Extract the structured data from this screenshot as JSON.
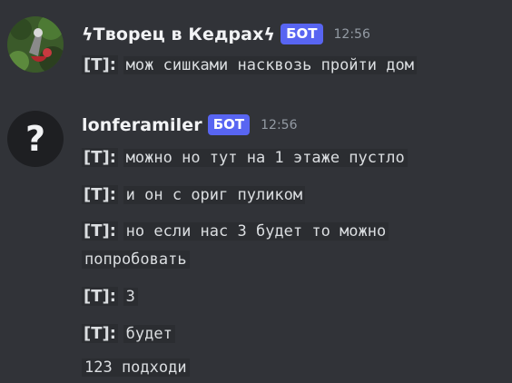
{
  "messages": [
    {
      "username": "ϟТворец в Кедрахϟ",
      "badge": "БОТ",
      "time": "12:56",
      "lines": [
        {
          "tag": "[T]:",
          "text": "мож сишками насквозь пройти дом"
        }
      ]
    },
    {
      "username": "lonferamiler",
      "badge": "БОТ",
      "time": "12:56",
      "avatar_glyph": "?",
      "lines": [
        {
          "tag": "[T]:",
          "text": "можно но тут на 1 этаже пустло"
        },
        {
          "tag": "[T]:",
          "text": "и он с ориг пуликом"
        },
        {
          "tag": "[T]:",
          "text": "но если нас 3 будет то можно",
          "text2": "попробовать"
        },
        {
          "tag": "[T]:",
          "text": "3"
        },
        {
          "tag": "[T]:",
          "text": "будет"
        },
        {
          "tag": "",
          "text": "123 подходи"
        }
      ]
    }
  ]
}
